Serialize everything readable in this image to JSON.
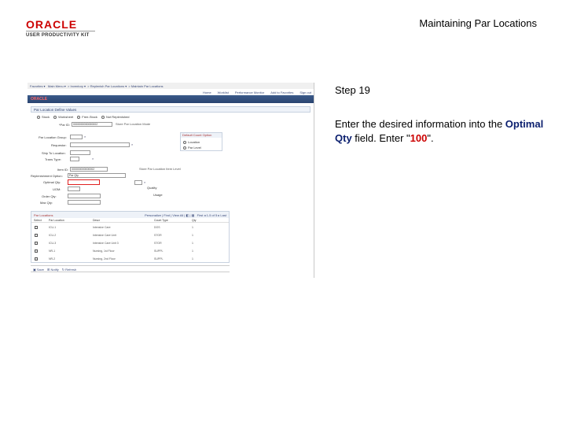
{
  "header": {
    "logo_word": "ORACLE",
    "logo_sub": "USER PRODUCTIVITY KIT",
    "title": "Maintaining Par Locations"
  },
  "step": {
    "title": "Step 19",
    "instr_pre": "Enter the desired information into the ",
    "field_name": "Optimal Qty",
    "instr_mid": " field. Enter \"",
    "value": "100",
    "instr_post": "\"."
  },
  "colors": {
    "highlight": "#e02020",
    "brand": "#cc0000",
    "field_name": "#0a1e6e"
  }
}
